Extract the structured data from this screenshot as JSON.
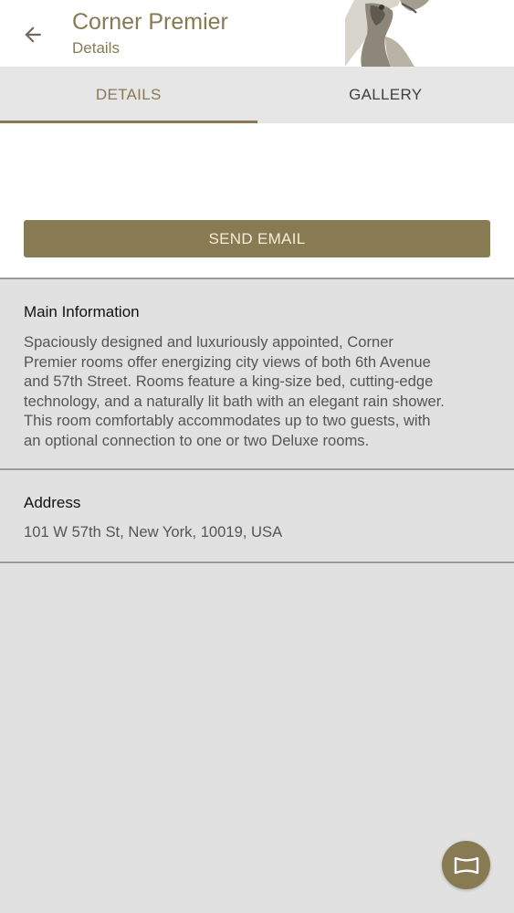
{
  "colors": {
    "accent": "#877a52",
    "button_text": "#f4ecd7",
    "background": "#e1e1e1"
  },
  "header": {
    "back_icon": "arrow-left-icon",
    "title": "Corner Premier",
    "subtitle": "Details"
  },
  "tabs": [
    {
      "label": "DETAILS",
      "active": true
    },
    {
      "label": "GALLERY",
      "active": false
    }
  ],
  "actions": {
    "send_email_label": "SEND EMAIL"
  },
  "main_information": {
    "heading": "Main Information",
    "lines": [
      "Spaciously designed and luxuriously appointed, Corner",
      "Premier rooms offer energizing city views of both 6th Avenue",
      "and 57th Street. Rooms feature a king-size bed, cutting-edge",
      "technology, and a naturally lit bath with an elegant rain shower.",
      "This room comfortably accommodates up to two guests, with",
      "an optional connection to one or two Deluxe rooms."
    ]
  },
  "address": {
    "heading": "Address",
    "value": "101 W 57th St, New York, 10019, USA"
  },
  "fab": {
    "icon": "panorama-icon"
  }
}
